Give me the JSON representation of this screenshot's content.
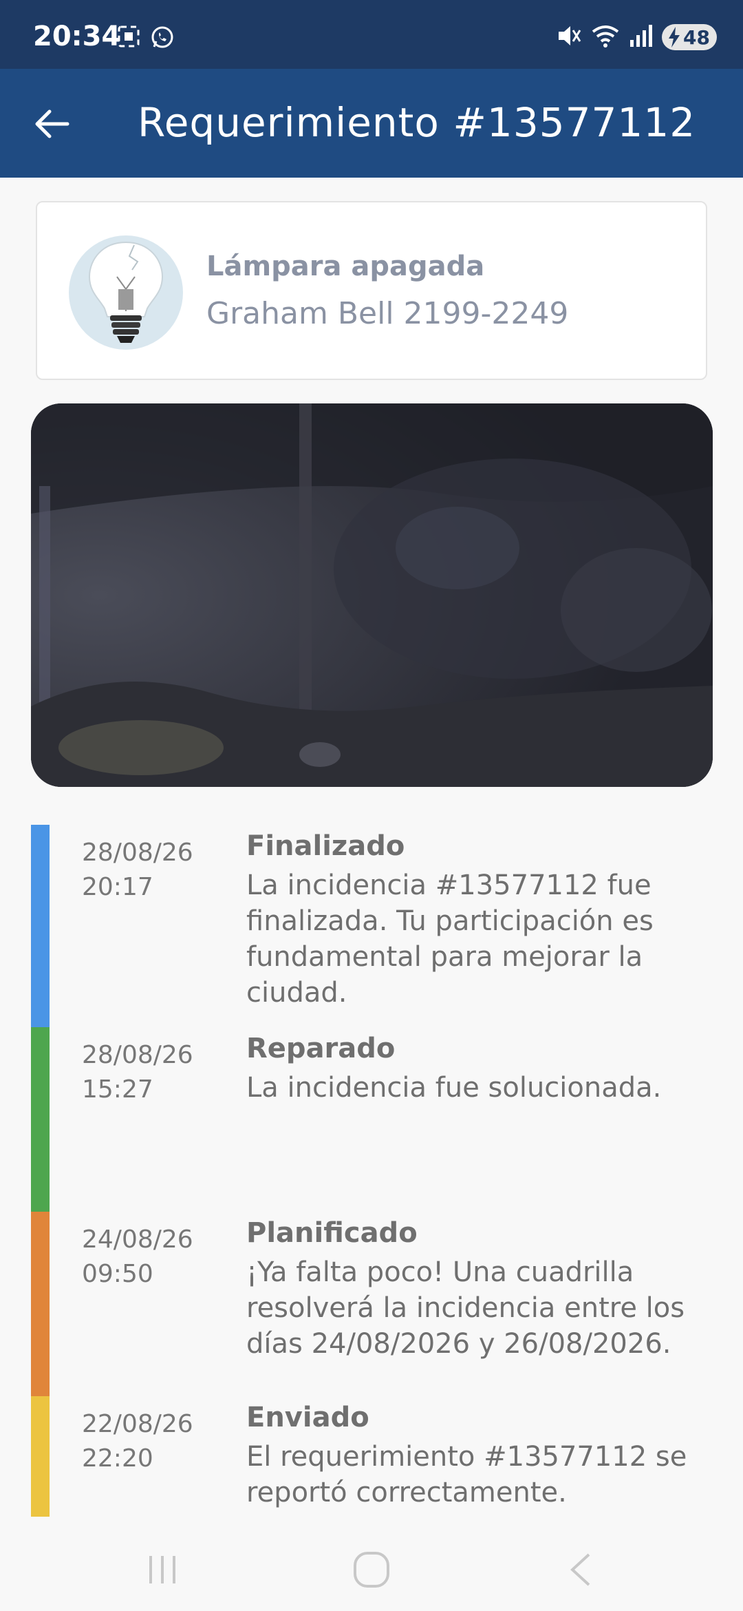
{
  "status_bar": {
    "time": "20:34",
    "battery": "48",
    "icons": [
      "screenshot-icon",
      "whatsapp-icon",
      "mute-icon",
      "wifi-icon",
      "signal-icon",
      "battery-icon"
    ]
  },
  "app_bar": {
    "back_icon": "arrow-left-icon",
    "title": "Requerimiento #13577112"
  },
  "summary": {
    "icon": "broken-bulb-icon",
    "title": "Lámpara apagada",
    "address": "Graham Bell 2199-2249"
  },
  "timeline": [
    {
      "date": "28/08/26",
      "time": "20:17",
      "status": "Finalizado",
      "description": "La incidencia #13577112 fue finalizada. Tu participación es fundamental para mejorar la ciudad.",
      "color": "#4a95e6"
    },
    {
      "date": "28/08/26",
      "time": "15:27",
      "status": "Reparado",
      "description": "La incidencia fue solucionada.",
      "color": "#4ea64e"
    },
    {
      "date": "24/08/26",
      "time": "09:50",
      "status": "Planificado",
      "description": "¡Ya falta poco! Una cuadrilla resolverá la incidencia entre los días 24/08/2026 y 26/08/2026.",
      "color": "#e0853a"
    },
    {
      "date": "22/08/26",
      "time": "22:20",
      "status": "Enviado",
      "description": "El requerimiento #13577112 se reportó correctamente.",
      "color": "#ecc440"
    }
  ],
  "nav_bar": {
    "icons": [
      "recents-icon",
      "home-icon",
      "back-icon"
    ]
  },
  "colors": {
    "status_bar": "#1e3a64",
    "app_bar": "#1f4b82",
    "background": "#f8f8f8"
  }
}
